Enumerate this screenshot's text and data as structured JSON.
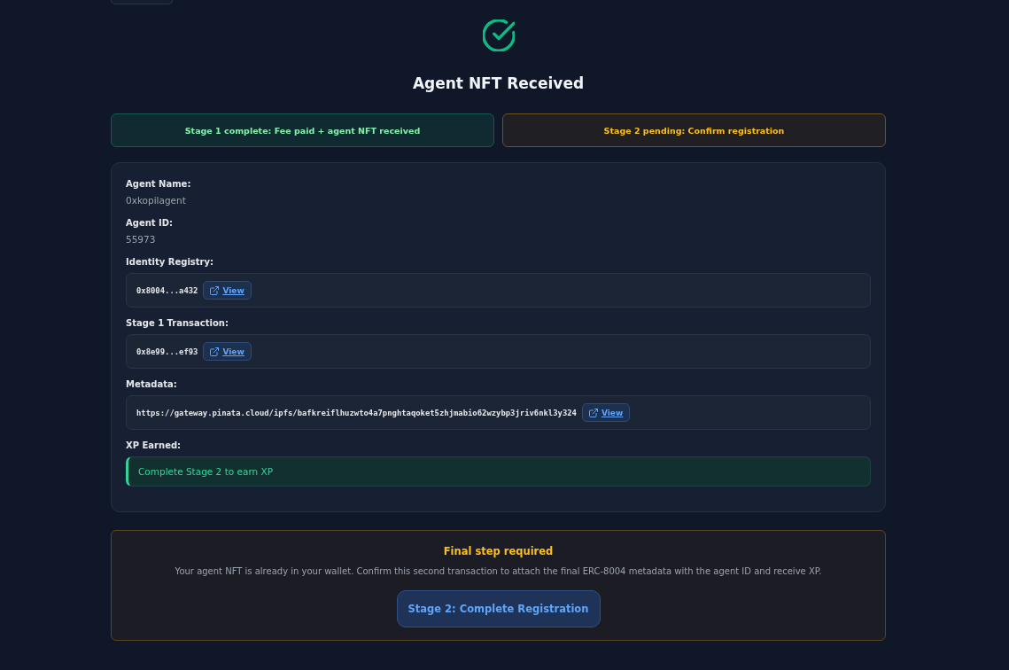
{
  "header": {
    "title": "Agent NFT Received"
  },
  "stages": [
    {
      "kind": "complete",
      "label": "Stage 1 complete: Fee paid + agent NFT received"
    },
    {
      "kind": "pending",
      "label": "Stage 2 pending: Confirm registration"
    }
  ],
  "details": [
    {
      "kind": "text",
      "label": "Agent Name:",
      "value": "0xkopilagent"
    },
    {
      "kind": "text",
      "label": "Agent ID:",
      "value": "55973"
    },
    {
      "kind": "address",
      "label": "Identity Registry:",
      "value": "0x8004...a432",
      "link": "View"
    },
    {
      "kind": "address",
      "label": "Stage 1 Transaction:",
      "value": "0x8e99...ef93",
      "link": "View"
    },
    {
      "kind": "address",
      "label": "Metadata:",
      "value": "https://gateway.pinata.cloud/ipfs/bafkreiflhuzwto4a7pnghtaqoket5zhjmabio62wzybp3jriv6nkl3y324",
      "link": "View"
    },
    {
      "kind": "note",
      "label": "XP Earned:",
      "value": "Complete Stage 2 to earn XP"
    }
  ],
  "final_step": {
    "title": "Final step required",
    "message": "Your agent NFT is already in your wallet. Confirm this second transaction to attach the final ERC-8004 metadata with the agent ID and receive XP.",
    "button": "Stage 2: Complete Registration"
  }
}
